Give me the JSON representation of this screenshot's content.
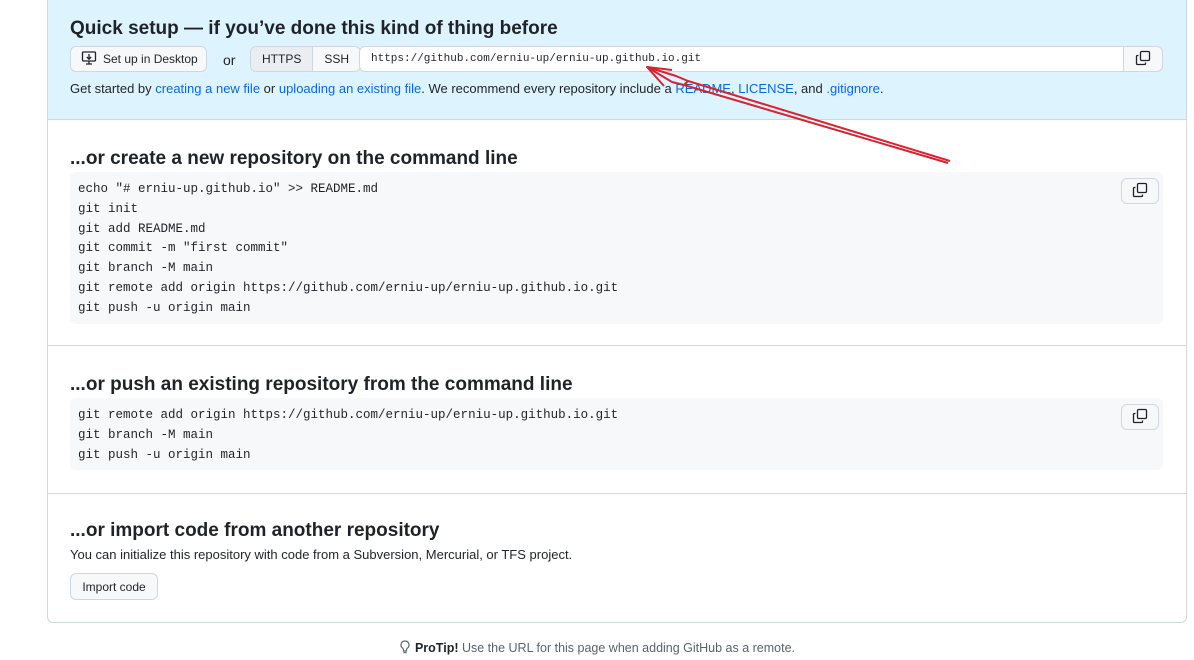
{
  "quick_setup": {
    "title": "Quick setup — if you’ve done this kind of thing before",
    "desktop_button": "Set up in Desktop",
    "or_label": "or",
    "protocols": [
      "HTTPS",
      "SSH"
    ],
    "selected_protocol": "HTTPS",
    "clone_url": "https://github.com/erniu-up/erniu-up.github.io.git",
    "get_started": {
      "prefix": "Get started by ",
      "link_new_file": "creating a new file",
      "or_text": " or ",
      "link_upload": "uploading an existing file",
      "middle": ". We recommend every repository include a ",
      "link_readme": "README",
      "comma1": ", ",
      "link_license": "LICENSE",
      "and_text": ", and ",
      "link_gitignore": ".gitignore",
      "suffix": "."
    }
  },
  "new_repo": {
    "title": "...or create a new repository on the command line",
    "lines": [
      "echo \"# erniu-up.github.io\" >> README.md",
      "git init",
      "git add README.md",
      "git commit -m \"first commit\"",
      "git branch -M main",
      "git remote add origin https://github.com/erniu-up/erniu-up.github.io.git",
      "git push -u origin main"
    ]
  },
  "push_existing": {
    "title": "...or push an existing repository from the command line",
    "lines": [
      "git remote add origin https://github.com/erniu-up/erniu-up.github.io.git",
      "git branch -M main",
      "git push -u origin main"
    ]
  },
  "import": {
    "title": "...or import code from another repository",
    "description": "You can initialize this repository with code from a Subversion, Mercurial, or TFS project.",
    "button": "Import code"
  },
  "protip": {
    "label": "ProTip!",
    "text": " Use the URL for this page when adding GitHub as a remote."
  },
  "icons": {
    "desktop": "desktop-download-icon",
    "copy": "copy-icon",
    "bulb": "light-bulb-icon"
  },
  "colors": {
    "quick_bg": "#ddf4ff",
    "link": "#0969da",
    "annotation_arrow": "#d9232e"
  }
}
